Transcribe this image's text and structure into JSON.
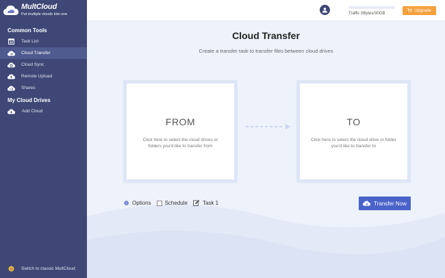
{
  "brand": {
    "name": "MultCloud",
    "tagline": "Put multiple clouds into one"
  },
  "sidebar": {
    "common_tools_title": "Common Tools",
    "tools": [
      {
        "label": "Task List",
        "icon": "task-list-icon"
      },
      {
        "label": "Cloud Transfer",
        "icon": "cloud-transfer-icon",
        "active": true
      },
      {
        "label": "Cloud Sync",
        "icon": "cloud-sync-icon"
      },
      {
        "label": "Remote Upload",
        "icon": "remote-upload-icon"
      },
      {
        "label": "Shares",
        "icon": "shares-icon"
      }
    ],
    "drives_title": "My Cloud Drives",
    "add_cloud": "Add Cloud",
    "classic_link": "Switch to classic MultCloud"
  },
  "header": {
    "traffic_text": "Traffic 0Bytes/30GB",
    "traffic_used_fraction": 0,
    "upgrade_label": "Upgrade"
  },
  "main": {
    "title": "Cloud Transfer",
    "subtitle": "Create a transfer task to transfer files between cloud drives",
    "from": {
      "heading": "FROM",
      "description": "Click here to select the cloud drives or folders you'd like to transfer from"
    },
    "to": {
      "heading": "TO",
      "description": "Click here to select the cloud drive or folder you'd like to transfer to"
    },
    "options_label": "Options",
    "schedule_label": "Schedule",
    "task_name": "Task 1",
    "transfer_button": "Transfer Now"
  },
  "colors": {
    "sidebar_bg": "#3e4775",
    "sidebar_active": "#4f5a8f",
    "primary": "#4a63c9",
    "upgrade": "#f5a03c",
    "main_bg": "#eef2fb"
  }
}
